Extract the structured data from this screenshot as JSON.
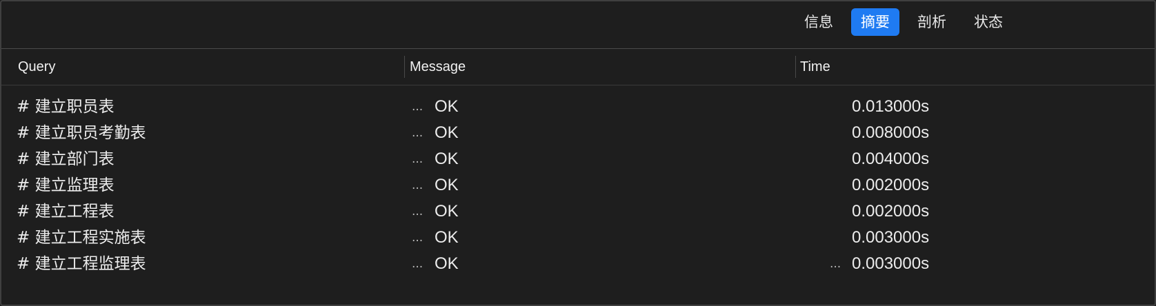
{
  "tabs": [
    {
      "label": "信息",
      "active": false
    },
    {
      "label": "摘要",
      "active": true
    },
    {
      "label": "剖析",
      "active": false
    },
    {
      "label": "状态",
      "active": false
    }
  ],
  "columns": {
    "query": "Query",
    "message": "Message",
    "time": "Time"
  },
  "truncation_marker": "...",
  "rows": [
    {
      "query": "# 建立职员表",
      "message": "OK",
      "time": "0.013000s",
      "message_truncated": false
    },
    {
      "query": "# 建立职员考勤表",
      "message": "OK",
      "time": "0.008000s",
      "message_truncated": false
    },
    {
      "query": "# 建立部门表",
      "message": "OK",
      "time": "0.004000s",
      "message_truncated": false
    },
    {
      "query": "# 建立监理表",
      "message": "OK",
      "time": "0.002000s",
      "message_truncated": false
    },
    {
      "query": "# 建立工程表",
      "message": "OK",
      "time": "0.002000s",
      "message_truncated": false
    },
    {
      "query": "# 建立工程实施表",
      "message": "OK",
      "time": "0.003000s",
      "message_truncated": false
    },
    {
      "query": "# 建立工程监理表",
      "message": "OK",
      "time": "0.003000s",
      "message_truncated": true
    }
  ],
  "colors": {
    "background": "#1e1e1e",
    "accent": "#1f7bf2",
    "text": "#ececec"
  }
}
